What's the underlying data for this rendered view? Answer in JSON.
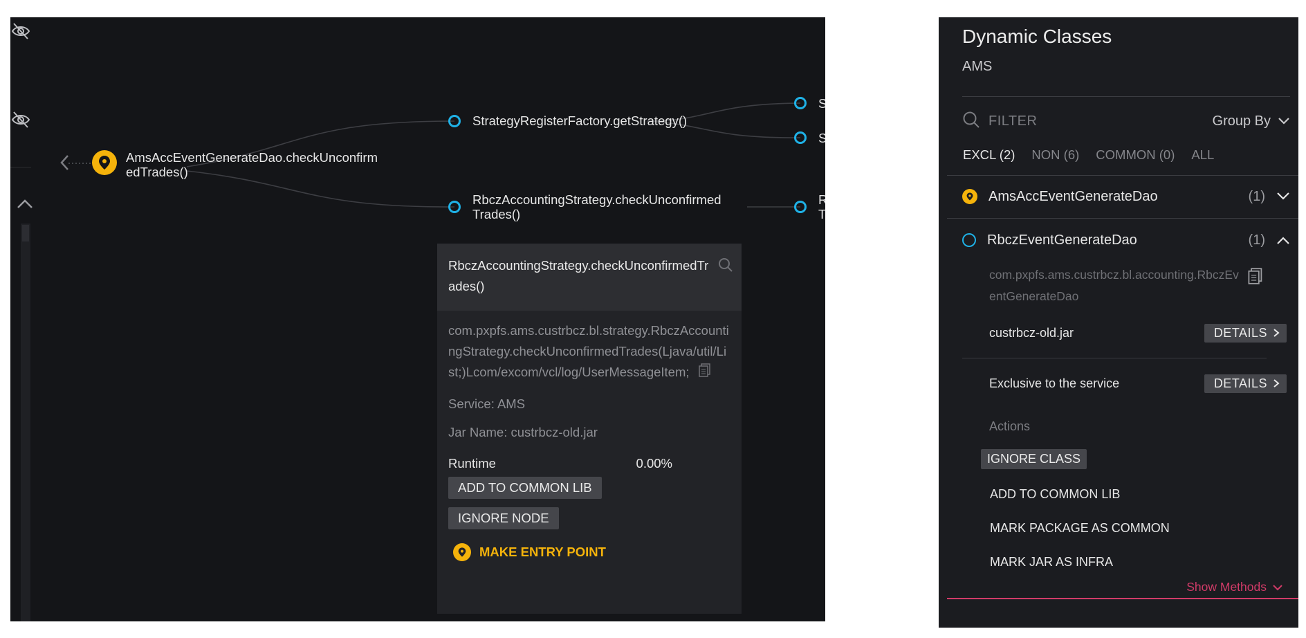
{
  "graph": {
    "root_node": {
      "label_line1": "AmsAccEventGenerateDao.checkUnconfirm",
      "label_line2": "edTrades()",
      "icon": "location-pin-icon"
    },
    "nodes": [
      {
        "label": "StrategyRegisterFactory.getStrategy()"
      },
      {
        "label_line1": "RbczAccountingStrategy.checkUnconfirmed",
        "label_line2": "Trades()"
      }
    ],
    "truncated_nodes": [
      "S",
      "S",
      "R",
      "T"
    ],
    "icons": {
      "hide": "eye-slash-icon",
      "back": "chevron-left-icon",
      "collapse": "chevron-up-icon"
    }
  },
  "popup": {
    "title": "RbczAccountingStrategy.checkUnconfirmedTrades()",
    "fqn": "com.pxpfs.ams.custrbcz.bl.strategy.RbczAccountingStrategy.checkUnconfirmedTrades(Ljava/util/List;)Lcom/excom/vcl/log/UserMessageItem;",
    "service": "Service: AMS",
    "jar": "Jar Name: custrbcz-old.jar",
    "runtime_label": "Runtime",
    "runtime_value": "0.00%",
    "add_common_lib": "ADD TO COMMON LIB",
    "ignore_node": "IGNORE NODE",
    "make_entry_point": "MAKE ENTRY POINT"
  },
  "panel": {
    "title": "Dynamic Classes",
    "subtitle": "AMS",
    "filter_placeholder": "FILTER",
    "group_by": "Group By",
    "tabs": [
      {
        "label": "EXCL (2)",
        "active": true
      },
      {
        "label": "NON (6)",
        "active": false
      },
      {
        "label": "COMMON (0)",
        "active": false
      },
      {
        "label": "ALL",
        "active": false
      }
    ],
    "classes": [
      {
        "name": "AmsAccEventGenerateDao",
        "count": "(1)",
        "expanded": false
      },
      {
        "name": "RbczEventGenerateDao",
        "count": "(1)",
        "expanded": true
      }
    ],
    "package": "com.pxpfs.ams.custrbcz.bl.accounting.RbczEventGenerateDao",
    "jar": "custrbcz-old.jar",
    "details_label": "DETAILS",
    "exclusive_label": "Exclusive to the service",
    "actions_label": "Actions",
    "actions": {
      "ignore_class": "IGNORE CLASS",
      "add_common_lib": "ADD TO COMMON LIB",
      "mark_package": "MARK PACKAGE AS COMMON",
      "mark_jar": "MARK JAR AS INFRA"
    },
    "show_methods": "Show Methods",
    "colors": {
      "accent_pink": "#d13b68",
      "pin_yellow": "#f5b30b",
      "ring_blue": "#1fb1e6"
    }
  }
}
